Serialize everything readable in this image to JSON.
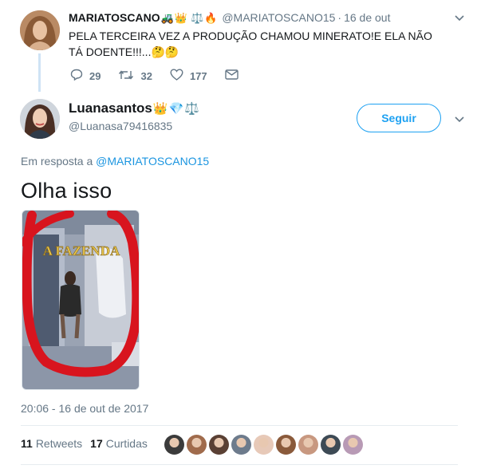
{
  "parent_tweet": {
    "display_name": "MARIATOSCANO",
    "name_emojis": [
      "🚜",
      "👑",
      "⚖️",
      "🔥"
    ],
    "handle": "@MARIATOSCANO15",
    "separator": "·",
    "time": "16 de out",
    "text": "PELA TERCEIRA VEZ A PRODUÇÃO CHAMOU MINERATO!E ELA NÃO TÁ DOENTE!!!...🤔🤔",
    "replies": "29",
    "retweets": "32",
    "likes": "177",
    "icons": [
      "reply-icon",
      "retweet-icon",
      "like-icon",
      "direct-message-icon",
      "chevron-down-icon"
    ]
  },
  "main_tweet": {
    "display_name": "Luanasantos",
    "name_emojis": [
      "👑",
      "💎",
      "⚖️"
    ],
    "handle": "@Luanasa79416835",
    "follow_label": "Seguir",
    "reply_prefix": "Em resposta a",
    "reply_to_handle": "@MARIATOSCANO15",
    "text": "Olha isso",
    "media_caption": "A FAZENDA",
    "timestamp": "20:06 - 16 de out de 2017",
    "retweets_count": "11",
    "retweets_label": "Retweets",
    "likes_count": "17",
    "likes_label": "Curtidas",
    "liker_colors": [
      "#3b3b3b",
      "#a06b4c",
      "#5a4034",
      "#6d7b8c",
      "#e7c9b8",
      "#8a5a3b",
      "#c89880",
      "#3d4a55",
      "#b89ab5"
    ]
  },
  "colors": {
    "accent": "#1da1f2",
    "link": "#1b95e0",
    "secondary_text": "#657786",
    "thread_line": "#cfe3f5"
  }
}
